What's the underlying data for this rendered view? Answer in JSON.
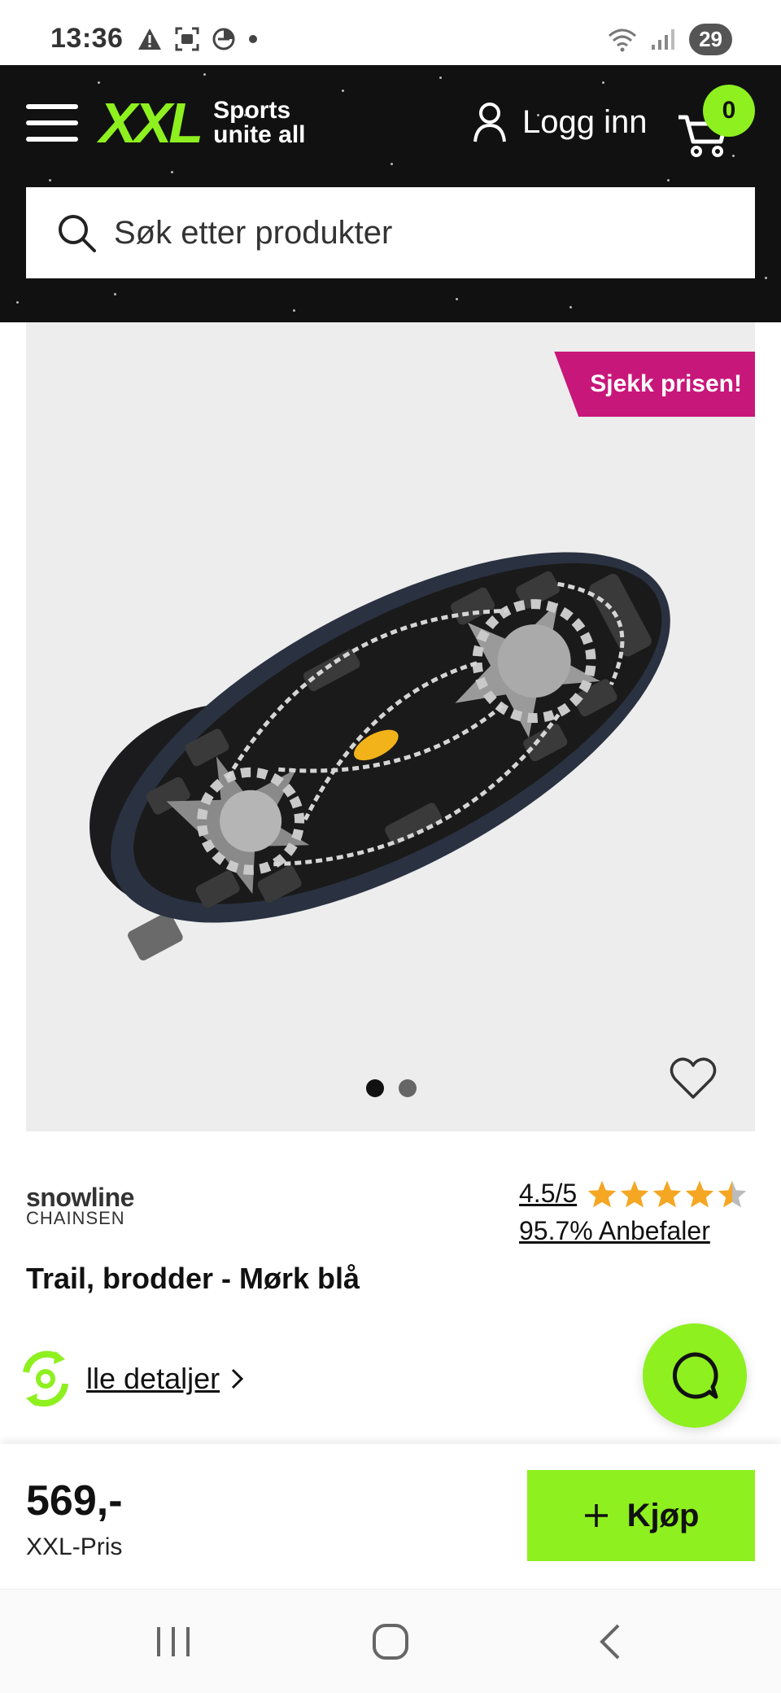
{
  "status_bar": {
    "time": "13:36",
    "battery": "29",
    "icons": [
      "warning-icon",
      "screenshot-icon",
      "data-saver-icon",
      "dot-icon",
      "wifi-icon",
      "signal-icon"
    ]
  },
  "header": {
    "logo_text": "XXL",
    "tagline_line1": "Sports",
    "tagline_line2": "unite all",
    "login_label": "Logg inn",
    "cart_count": "0",
    "brand_color": "#8ef01f",
    "background": "#111111"
  },
  "search": {
    "placeholder": "Søk etter produkter",
    "value": ""
  },
  "product": {
    "promo_tag": "Sjekk prisen!",
    "promo_color": "#c8177a",
    "image_count": 2,
    "active_image": 1,
    "brand_name": "snowline",
    "brand_sub": "CHAINSEN",
    "rating": "4.5/5",
    "rating_value": 4.5,
    "rating_max": 5,
    "recommend": "95.7% Anbefaler",
    "title": "Trail, brodder - Mørk blå",
    "details_link": "lle detaljer"
  },
  "price_bar": {
    "price": "569,-",
    "price_label": "XXL-Pris",
    "buy_label": "Kjøp"
  },
  "nav": {
    "items": [
      "recent-apps-icon",
      "home-icon",
      "back-icon"
    ]
  }
}
